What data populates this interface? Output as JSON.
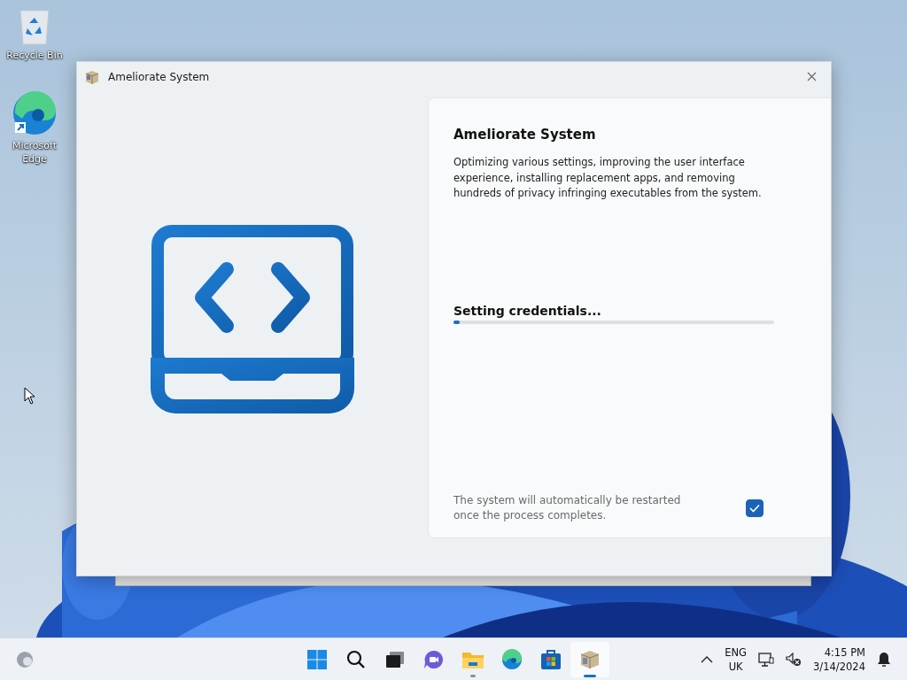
{
  "desktop_icons": [
    {
      "label": "Recycle Bin",
      "kind": "recycle"
    },
    {
      "label": "Microsoft Edge",
      "kind": "edge"
    }
  ],
  "window": {
    "title": "Ameliorate System",
    "heading": "Ameliorate System",
    "description": "Optimizing various settings, improving the user interface experience, installing replacement apps, and removing hundreds of privacy infringing executables from the system.",
    "progress": {
      "label": "Setting credentials...",
      "level": 0.02
    },
    "restart_note": "The system will automatically be restarted once the process completes.",
    "restart_checkbox": {
      "checked": true
    }
  },
  "taskbar": {
    "apps": [
      {
        "kind": "start",
        "running": false,
        "selected": false
      },
      {
        "kind": "search",
        "running": false,
        "selected": false
      },
      {
        "kind": "taskview",
        "running": false,
        "selected": false
      },
      {
        "kind": "chat",
        "running": false,
        "selected": false
      },
      {
        "kind": "explorer",
        "running": true,
        "selected": false
      },
      {
        "kind": "edge",
        "running": false,
        "selected": false
      },
      {
        "kind": "store",
        "running": false,
        "selected": false
      },
      {
        "kind": "package",
        "running": true,
        "selected": true
      }
    ],
    "language": "ENG",
    "region": "UK",
    "time": "4:15 PM",
    "date": "3/14/2024"
  }
}
